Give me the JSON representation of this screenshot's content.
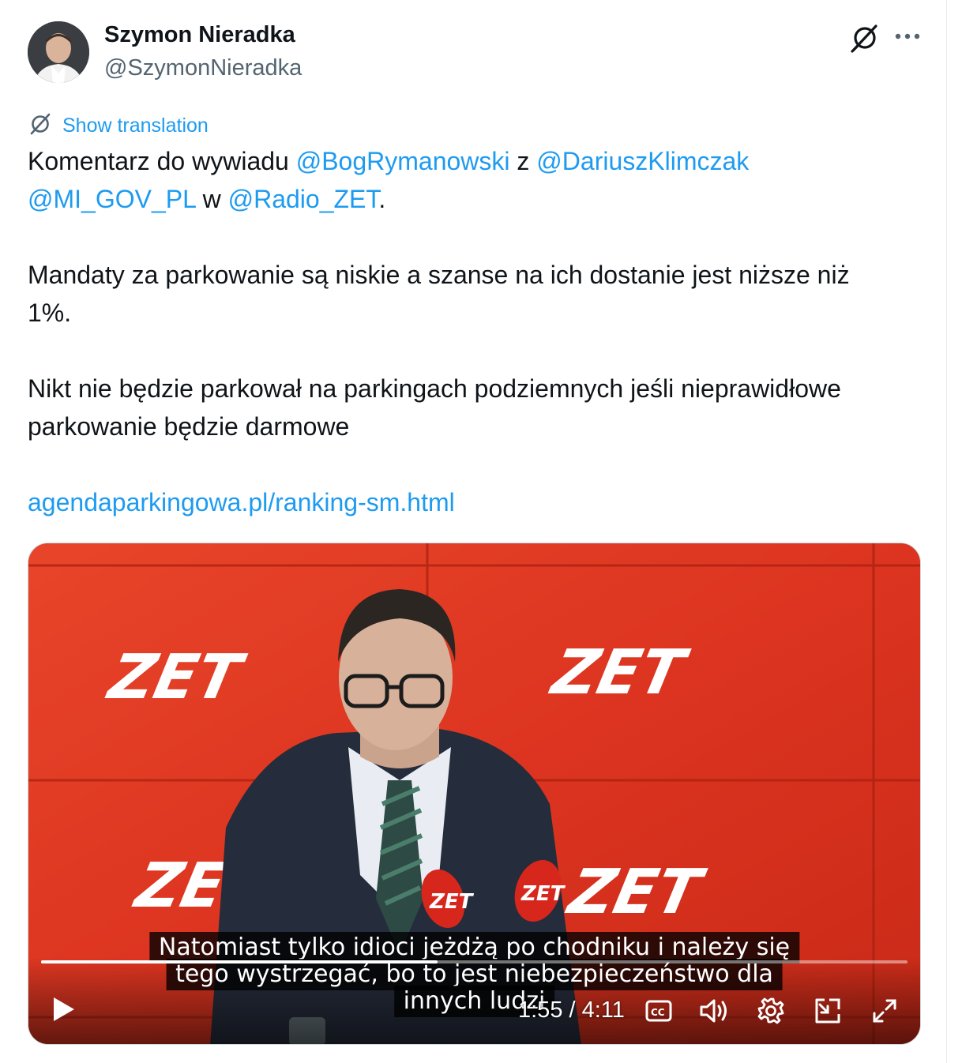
{
  "author": {
    "name": "Szymon Nieradka",
    "handle": "@SzymonNieradka"
  },
  "header_icons": {
    "grok": "grok-icon",
    "more": "more-icon"
  },
  "translation": {
    "label": "Show translation",
    "icon": "translate-icon"
  },
  "tweet": {
    "line1_prefix": "Komentarz do wywiadu ",
    "mention1": "@BogRymanowski",
    "line1_mid": " z ",
    "mention2": "@DariuszKlimczak",
    "mention3": "@MI_GOV_PL",
    "line2_mid": " w ",
    "mention4": "@Radio_ZET",
    "line2_suffix": ".",
    "para2_line1": "Mandaty za parkowanie są niskie a szanse na ich dostanie jest niższe niż",
    "para2_line2": "1%.",
    "para3_line1": "Nikt nie będzie parkował na parkingach podziemnych jeśli nieprawidłowe",
    "para3_line2": "parkowanie będzie darmowe",
    "link": "agendaparkingowa.pl/ranking-sm.html"
  },
  "video": {
    "subtitle_line1": "Natomiast tylko idioci jeżdżą po chodniku i należy się",
    "subtitle_line2": "tego wystrzegać, bo to jest niebezpieczeństwo dla",
    "subtitle_line3": "innych ludzi",
    "current_time": "1:55",
    "separator": " / ",
    "duration": "4:11",
    "progress_fraction": 0.458,
    "logo_text": "ZET",
    "icons": [
      "play-icon",
      "captions-icon",
      "volume-icon",
      "settings-icon",
      "pip-icon",
      "fullscreen-icon"
    ]
  },
  "colors": {
    "link": "#1d9bf0",
    "studio_red": "#e0341f",
    "text": "#0f1419",
    "secondary": "#536471"
  }
}
